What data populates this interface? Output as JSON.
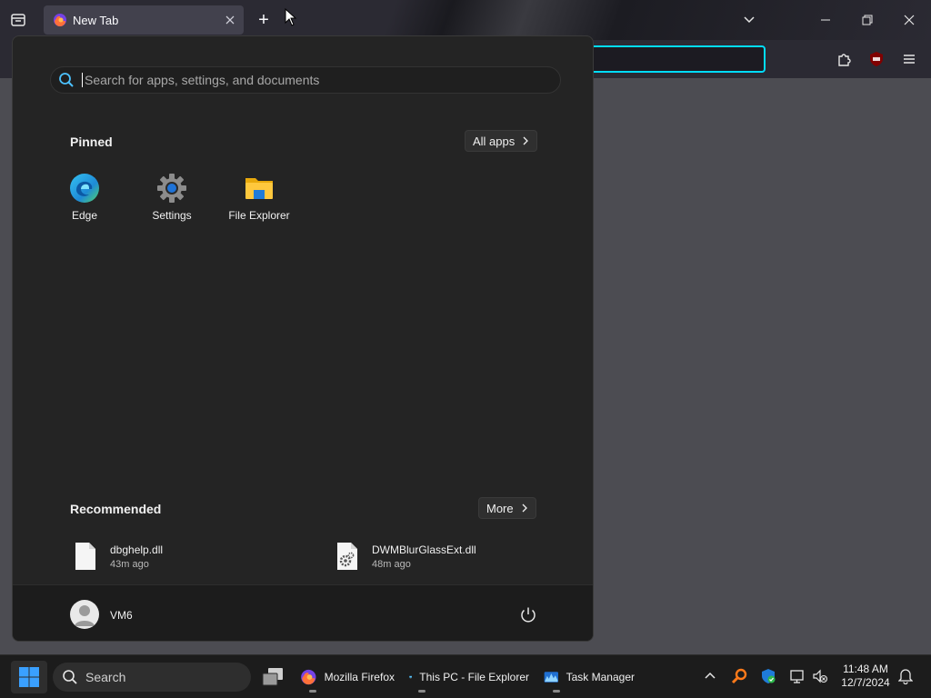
{
  "browser": {
    "tab_title": "New Tab",
    "new_tab_symbol": "+"
  },
  "start_menu": {
    "search_placeholder": "Search for apps, settings, and documents",
    "pinned_title": "Pinned",
    "all_apps_label": "All apps",
    "pinned_apps": [
      {
        "label": "Edge",
        "icon": "edge-icon"
      },
      {
        "label": "Settings",
        "icon": "settings-gear-icon"
      },
      {
        "label": "File Explorer",
        "icon": "folder-icon"
      }
    ],
    "recommended_title": "Recommended",
    "more_label": "More",
    "recommended": [
      {
        "name": "dbghelp.dll",
        "time": "43m ago",
        "icon": "file-icon"
      },
      {
        "name": "DWMBlurGlassExt.dll",
        "time": "48m ago",
        "icon": "settings-file-icon"
      }
    ],
    "user_name": "VM6"
  },
  "taskbar": {
    "search_label": "Search",
    "apps": [
      {
        "label": "Mozilla Firefox",
        "icon": "firefox-icon"
      },
      {
        "label": "This PC - File Explorer",
        "icon": "monitor-icon"
      },
      {
        "label": "Task Manager",
        "icon": "task-manager-icon"
      }
    ],
    "clock_time": "11:48 AM",
    "clock_date": "12/7/2024"
  },
  "colors": {
    "accent": "#00ddff",
    "start_menu_bg": "#242424",
    "taskbar_bg": "#1c1c1c",
    "windows_blue": "#3aa0ff"
  }
}
